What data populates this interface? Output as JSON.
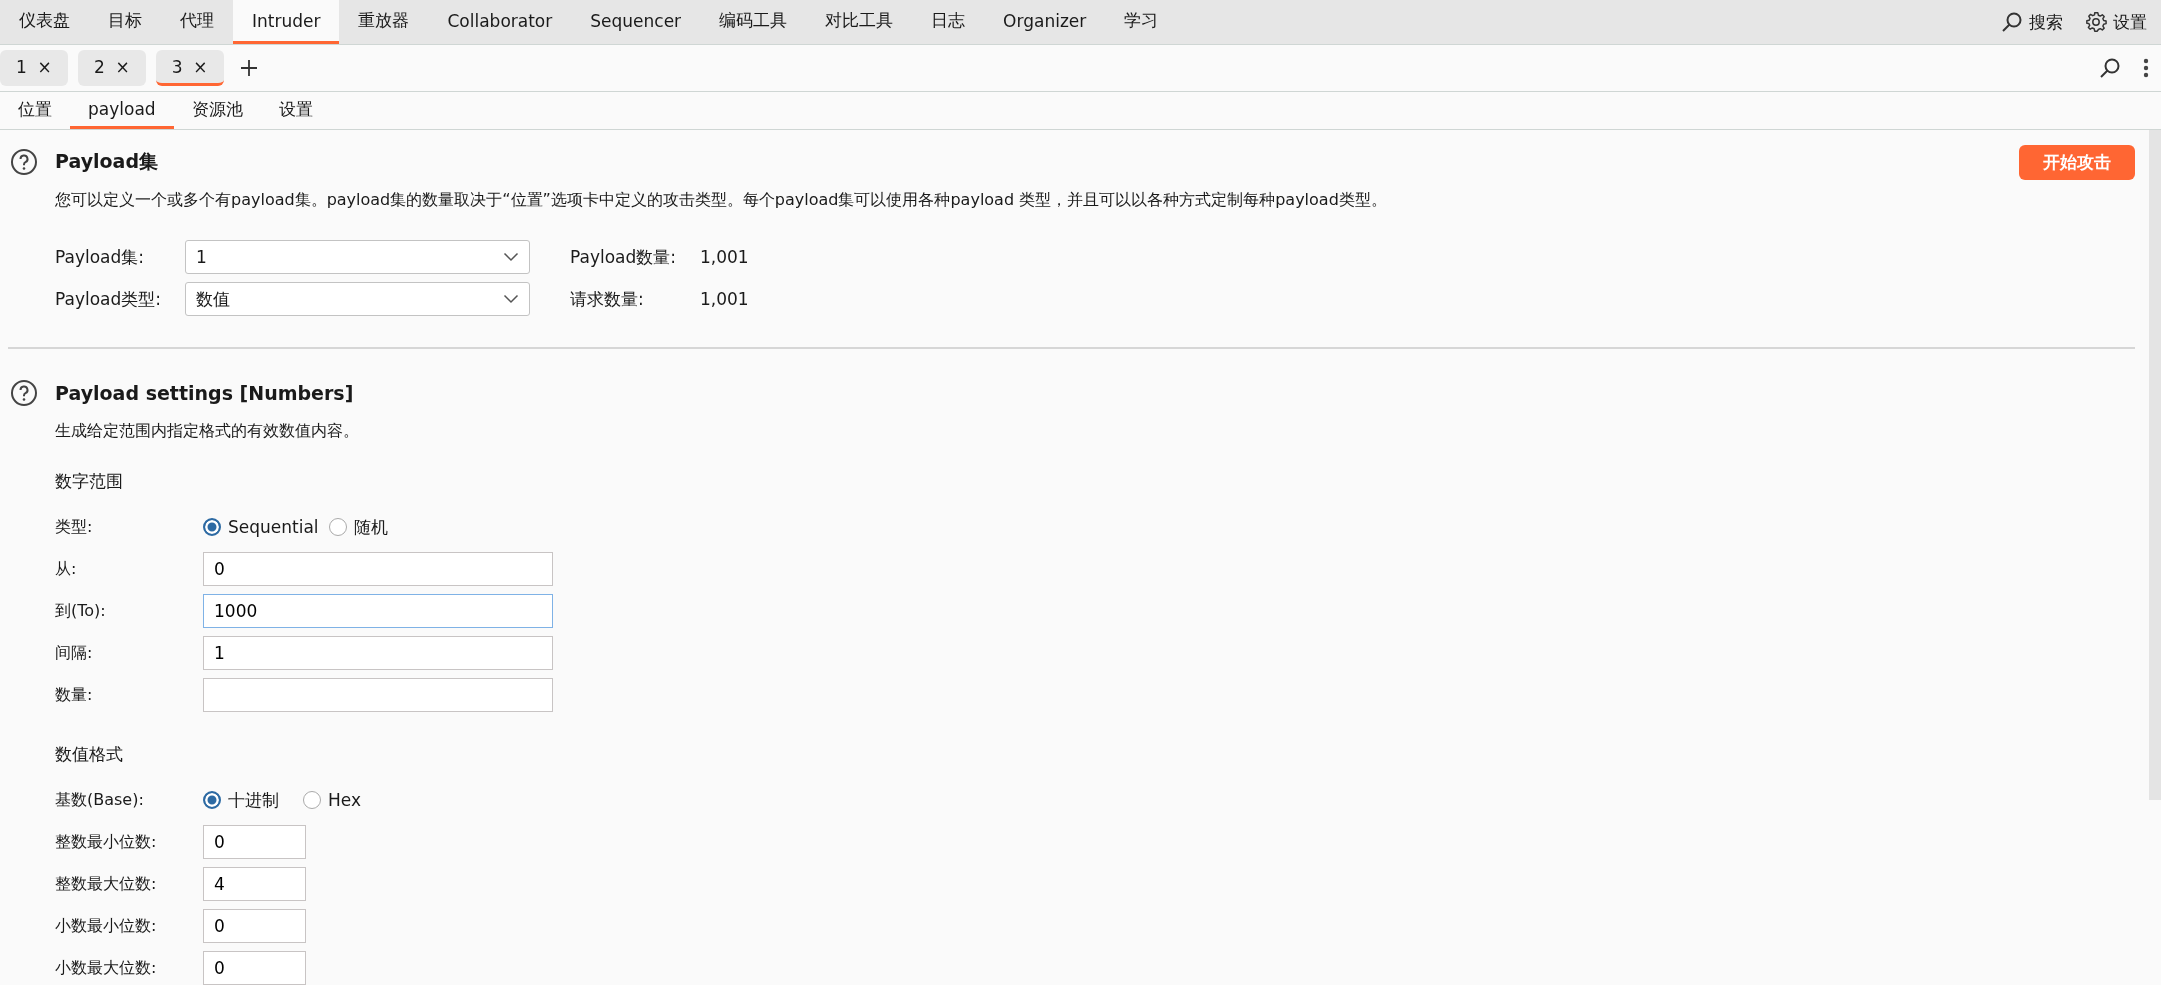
{
  "menu": [
    {
      "label": "仪表盘",
      "selected": false
    },
    {
      "label": "目标",
      "selected": false
    },
    {
      "label": "代理",
      "selected": false
    },
    {
      "label": "Intruder",
      "selected": true
    },
    {
      "label": "重放器",
      "selected": false
    },
    {
      "label": "Collaborator",
      "selected": false
    },
    {
      "label": "Sequencer",
      "selected": false
    },
    {
      "label": "编码工具",
      "selected": false
    },
    {
      "label": "对比工具",
      "selected": false
    },
    {
      "label": "日志",
      "selected": false
    },
    {
      "label": "Organizer",
      "selected": false
    },
    {
      "label": "学习",
      "selected": false
    }
  ],
  "menu_actions": [
    {
      "label": "搜索",
      "kind": "search"
    },
    {
      "label": "设置",
      "kind": "settings"
    }
  ],
  "instance_tabs": [
    {
      "label": "1",
      "close": "×",
      "selected": false
    },
    {
      "label": "2",
      "close": "×",
      "selected": false
    },
    {
      "label": "3",
      "close": "×",
      "selected": true
    }
  ],
  "sub_tabs": [
    {
      "label": "位置",
      "selected": false
    },
    {
      "label": "payload",
      "selected": true
    },
    {
      "label": "资源池",
      "selected": false
    },
    {
      "label": "设置",
      "selected": false
    }
  ],
  "payload_sets": {
    "title": "Payload集",
    "start_button": "开始攻击",
    "description": "您可以定义一个或多个有payload集。payload集的数量取决于“位置”选项卡中定义的攻击类型。每个payload集可以使用各种payload 类型，并且可以以各种方式定制每种payload类型。",
    "fields": [
      {
        "label": "Payload集:",
        "value": "1",
        "stat_label": "Payload数量:",
        "stat_value": "1,001"
      },
      {
        "label": "Payload类型:",
        "value": "数值",
        "stat_label": "请求数量:",
        "stat_value": "1,001"
      }
    ]
  },
  "payload_settings": {
    "title": "Payload settings [Numbers]",
    "description": "生成给定范围内指定格式的有效数值内容。",
    "groups": [
      {
        "heading": "数字范围",
        "rows": [
          {
            "kind": "radio",
            "label": "类型:",
            "options": [
              {
                "label": "Sequential",
                "selected": true
              },
              {
                "label": "随机",
                "selected": false
              }
            ]
          },
          {
            "kind": "text",
            "label": "从:",
            "value": "0",
            "focused": false
          },
          {
            "kind": "text",
            "label": "到(To):",
            "value": "1000",
            "focused": true
          },
          {
            "kind": "text",
            "label": "间隔:",
            "value": "1",
            "focused": false
          },
          {
            "kind": "text",
            "label": "数量:",
            "focused": false
          }
        ]
      },
      {
        "heading": "数值格式",
        "rows": [
          {
            "kind": "radio",
            "label": "基数(Base):",
            "options": [
              {
                "label": "十进制",
                "selected": true
              },
              {
                "label": "Hex",
                "selected": false
              }
            ]
          },
          {
            "kind": "short",
            "label": "整数最小位数:",
            "value": "0",
            "focused": false
          },
          {
            "kind": "short",
            "label": "整数最大位数:",
            "value": "4",
            "focused": false
          },
          {
            "kind": "short",
            "label": "小数最小位数:",
            "value": "0",
            "focused": false
          },
          {
            "kind": "short",
            "label": "小数最大位数:",
            "value": "0",
            "focused": false
          }
        ]
      }
    ]
  }
}
